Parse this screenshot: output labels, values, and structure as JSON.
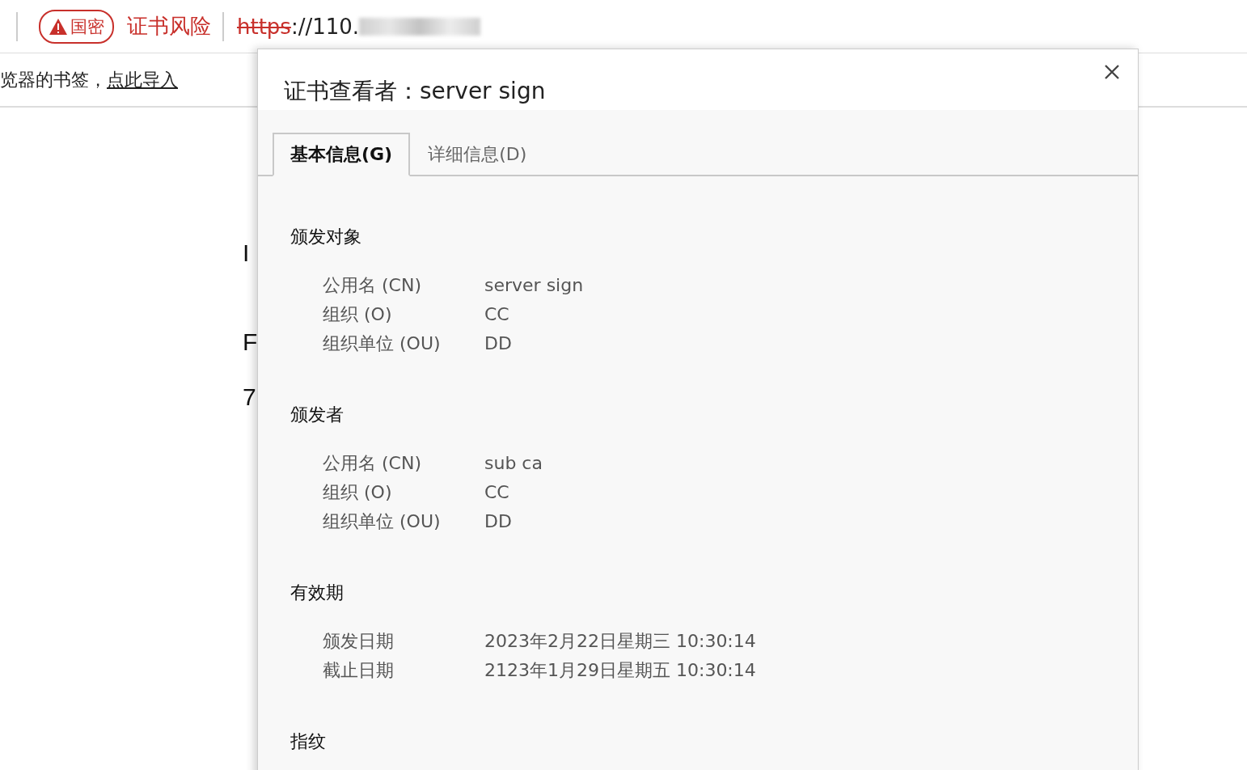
{
  "address_bar": {
    "badge": "国密",
    "security_warning": "证书风险",
    "url_scheme": "https",
    "url_rest": "://110."
  },
  "bookmarks_bar": {
    "message": "览器的书签，",
    "link": "点此导入"
  },
  "page_fragments": [
    "I",
    "F",
    "7"
  ],
  "dialog": {
    "title": "证书查看者：server sign",
    "tabs": [
      {
        "label": "基本信息(G)",
        "selected": true
      },
      {
        "label": "详细信息(D)",
        "selected": false
      }
    ],
    "sections": [
      {
        "heading": "颁发对象",
        "rows": [
          {
            "label": "公用名 (CN)",
            "value": "server sign"
          },
          {
            "label": "组织 (O)",
            "value": "CC"
          },
          {
            "label": "组织单位 (OU)",
            "value": "DD"
          }
        ]
      },
      {
        "heading": "颁发者",
        "rows": [
          {
            "label": "公用名 (CN)",
            "value": "sub ca"
          },
          {
            "label": "组织 (O)",
            "value": "CC"
          },
          {
            "label": "组织单位 (OU)",
            "value": "DD"
          }
        ]
      },
      {
        "heading": "有效期",
        "rows": [
          {
            "label": "颁发日期",
            "value": "2023年2月22日星期三 10:30:14"
          },
          {
            "label": "截止日期",
            "value": "2123年1月29日星期五 10:30:14"
          }
        ]
      },
      {
        "heading": "指纹"
      }
    ]
  }
}
